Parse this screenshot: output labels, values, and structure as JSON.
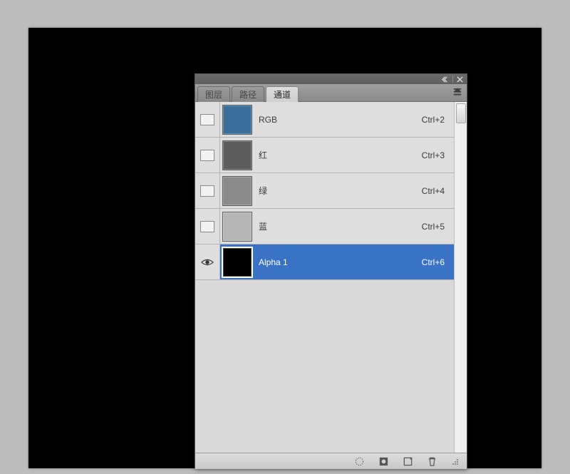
{
  "panel": {
    "header": {
      "collapse_icon": "collapse-left-icon",
      "close_icon": "close-icon"
    },
    "menu_icon": "panel-menu-icon",
    "tabs": [
      {
        "label": "图层",
        "active": false
      },
      {
        "label": "路径",
        "active": false
      },
      {
        "label": "通道",
        "active": true
      }
    ],
    "channels": [
      {
        "name": "RGB",
        "shortcut": "Ctrl+2",
        "swatch": "#3b6f9b",
        "visible": false,
        "selected": false
      },
      {
        "name": "红",
        "shortcut": "Ctrl+3",
        "swatch": "#5d5d5d",
        "visible": false,
        "selected": false
      },
      {
        "name": "绿",
        "shortcut": "Ctrl+4",
        "swatch": "#8a8a8a",
        "visible": false,
        "selected": false
      },
      {
        "name": "蓝",
        "shortcut": "Ctrl+5",
        "swatch": "#b7b7b7",
        "visible": false,
        "selected": false
      },
      {
        "name": "Alpha 1",
        "shortcut": "Ctrl+6",
        "swatch": "#010101",
        "visible": true,
        "selected": true
      }
    ],
    "footer": {
      "buttons": [
        "load-selection-icon",
        "save-selection-as-channel-icon",
        "new-channel-icon",
        "delete-channel-icon"
      ]
    }
  },
  "colors": {
    "workspace_bg": "#bcbcbc",
    "canvas_bg": "#020202",
    "panel_bg": "#d3d3d3",
    "row_bg": "#dedede",
    "selection_bg": "#3a72c6"
  }
}
